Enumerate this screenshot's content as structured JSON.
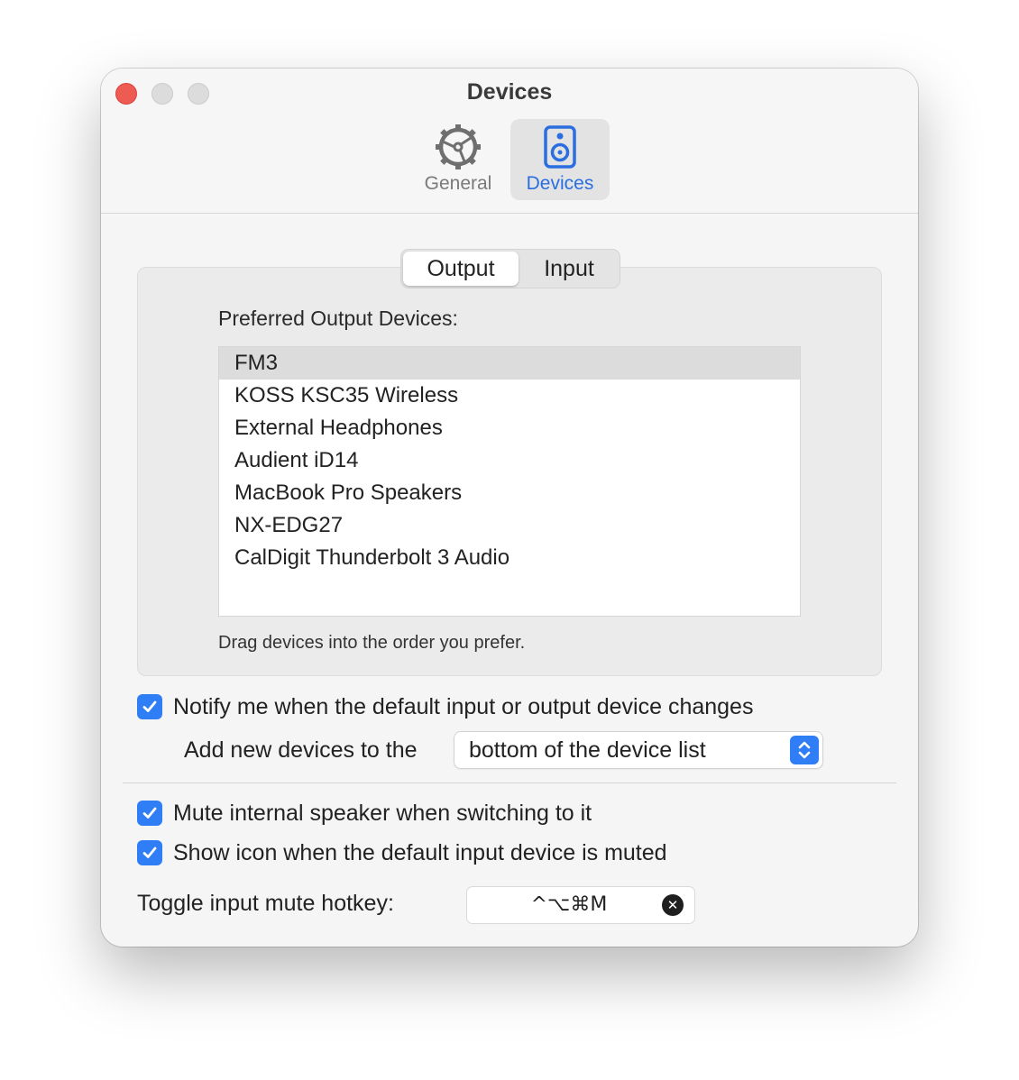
{
  "window": {
    "title": "Devices"
  },
  "toolbar": {
    "items": [
      {
        "label": "General",
        "icon": "gear-icon",
        "selected": false
      },
      {
        "label": "Devices",
        "icon": "speaker-icon",
        "selected": true
      }
    ]
  },
  "tabs": [
    {
      "label": "Output",
      "selected": true
    },
    {
      "label": "Input",
      "selected": false
    }
  ],
  "output": {
    "list_label": "Preferred Output Devices:",
    "devices": [
      "FM3",
      "KOSS KSC35 Wireless",
      "External Headphones",
      "Audient iD14",
      "MacBook Pro Speakers",
      "NX-EDG27",
      "CalDigit Thunderbolt 3 Audio"
    ],
    "selected_device": "FM3",
    "hint": "Drag devices into the order you prefer."
  },
  "options": {
    "notify": {
      "label": "Notify me when the default input or output device changes",
      "checked": true
    },
    "add_new": {
      "label": "Add new devices to the",
      "value": "bottom of the device list"
    },
    "mute_internal": {
      "label": "Mute internal speaker when switching to it",
      "checked": true
    },
    "show_icon": {
      "label": "Show icon when the default input device is muted",
      "checked": true
    },
    "hotkey": {
      "label": "Toggle input mute hotkey:",
      "value": "^⌥⌘M"
    }
  },
  "colors": {
    "accent": "#2f7ef6",
    "accent_text": "#2a6ee0",
    "close_button": "#ee5b52"
  }
}
